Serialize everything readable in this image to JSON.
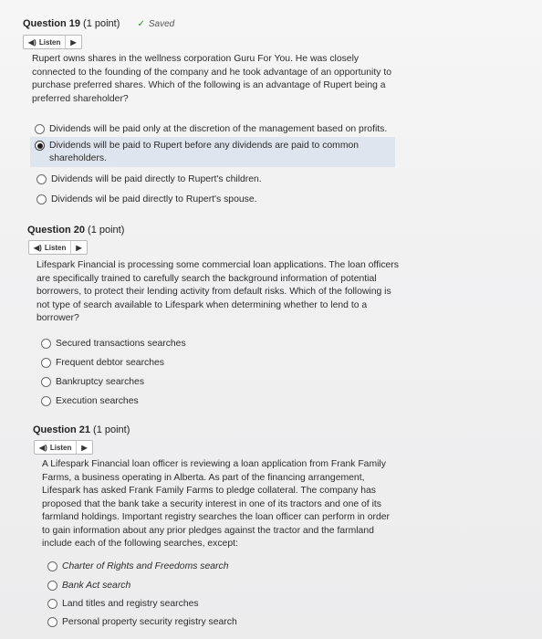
{
  "q19": {
    "title": "Question 19",
    "points": "(1 point)",
    "saved": "Saved",
    "listen": "Listen",
    "stem": "Rupert owns shares in the wellness corporation Guru For You. He was closely connected to the founding of the company and he took advantage of an opportunity to purchase preferred shares. Which of the following is an advantage of Rupert being a preferred shareholder?",
    "options": [
      "Dividends will be paid only at the discretion of the management based on profits.",
      "Dividends will be paid to Rupert before any dividends are paid to common shareholders.",
      "Dividends will be paid directly to Rupert's children.",
      "Dividends wil be paid directly to Rupert's spouse."
    ],
    "selected_index": 1
  },
  "q20": {
    "title": "Question 20",
    "points": "(1 point)",
    "listen": "Listen",
    "stem": "Lifespark Financial is processing some commercial loan applications. The loan officers are specifically trained to carefully search the background information of potential borrowers, to protect their lending activity from default risks. Which of the following is not type of search available to Lifespark when determining whether to lend to a borrower?",
    "options": [
      "Secured transactions searches",
      "Frequent debtor searches",
      "Bankruptcy searches",
      "Execution searches"
    ]
  },
  "q21": {
    "title": "Question 21",
    "points": "(1 point)",
    "listen": "Listen",
    "stem": "A Lifespark Financial loan officer is reviewing a loan application from Frank Family Farms, a business operating in Alberta. As part of the financing arrangement, Lifespark has asked Frank Family Farms to pledge collateral. The company has proposed that the bank take a security interest in one of its tractors and one of its farmland holdings. Important registry searches the loan officer can perform in order to gain information about any prior pledges against the tractor and the farmland include each of the following searches, except:",
    "options": [
      "Charter of Rights and Freedoms search",
      "Bank Act search",
      "Land titles and registry searches",
      "Personal property security registry search"
    ]
  }
}
